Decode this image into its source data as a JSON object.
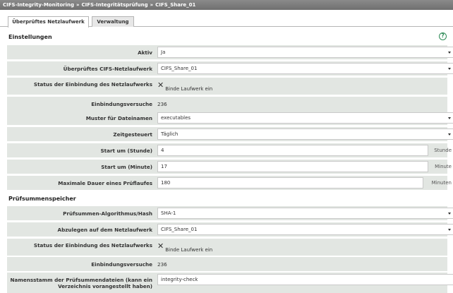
{
  "breadcrumb": [
    "CIFS-Integrity-Monitoring",
    "CIFS-Integritätsprüfung",
    "CIFS_Share_01"
  ],
  "breadcrumb_sep": "»",
  "tabs": [
    {
      "label": "Überprüftes Netzlaufwerk",
      "active": true
    },
    {
      "label": "Verwaltung",
      "active": false
    }
  ],
  "sections": {
    "settings": "Einstellungen",
    "checksum": "Prüfsummenspeicher"
  },
  "help_icon": "?",
  "fields": {
    "aktiv": {
      "label": "Aktiv",
      "value": "Ja"
    },
    "share": {
      "label": "Überprüftes CIFS-Netzlaufwerk",
      "value": "CIFS_Share_01"
    },
    "mount_status": {
      "label": "Status der Einbindung des Netzlaufwerks",
      "value": "Binde Laufwerk ein"
    },
    "mount_attempts": {
      "label": "Einbindungsversuche",
      "value": "236"
    },
    "pattern": {
      "label": "Muster für Dateinamen",
      "value": "executables"
    },
    "schedule": {
      "label": "Zeitgesteuert",
      "value": "Täglich"
    },
    "start_hour": {
      "label": "Start um (Stunde)",
      "value": "4",
      "unit": "Stunde"
    },
    "start_minute": {
      "label": "Start um (Minute)",
      "value": "17",
      "unit": "Minute"
    },
    "max_duration": {
      "label": "Maximale Dauer eines Prüflaufes",
      "value": "180",
      "unit": "Minuten"
    },
    "hash_algo": {
      "label": "Prüfsummen-Algorithmus/Hash",
      "value": "SHA-1"
    },
    "store_share": {
      "label": "Abzulegen auf dem Netzlaufwerk",
      "value": "CIFS_Share_01"
    },
    "mount_status2": {
      "label": "Status der Einbindung des Netzlaufwerks",
      "value": "Binde Laufwerk ein"
    },
    "mount_attempts2": {
      "label": "Einbindungsversuche",
      "value": "236"
    },
    "file_stem": {
      "label_line1": "Namensstamm der Prüfsummendateien (kann ein",
      "label_line2": "Verzeichnis vorangestellt haben)",
      "value": "integrity-check"
    }
  }
}
